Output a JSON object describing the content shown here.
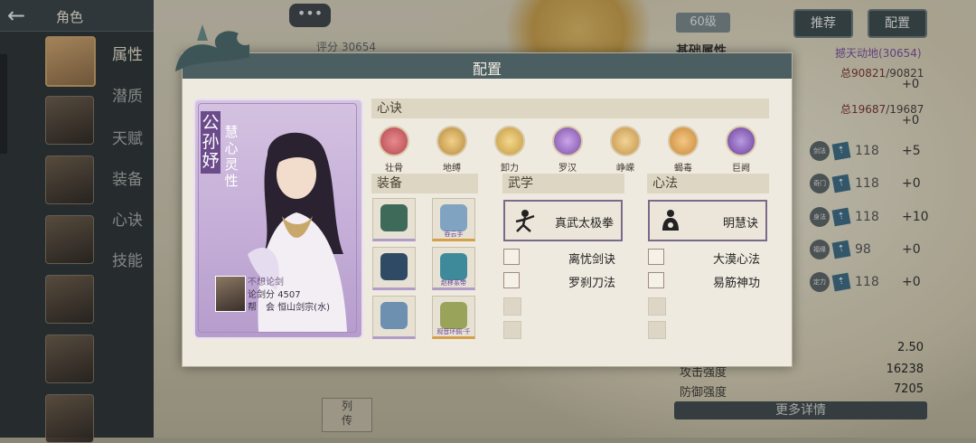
{
  "header": {
    "title": "角色",
    "back_icon": "back-arrow-icon"
  },
  "side_tabs": [
    "属性",
    "潜质",
    "天赋",
    "装备",
    "心诀",
    "技能"
  ],
  "chat": {
    "label": "•••"
  },
  "score_top": "评分 30654",
  "level": "60级",
  "buttons": {
    "recommend": "推荐",
    "config": "配置"
  },
  "right_panel": {
    "title": "基础属性",
    "score": "撼天动地(30654)",
    "hp": {
      "current": "总90821",
      "max": "/90821",
      "plus": "+0"
    },
    "mp": {
      "current": "总19687",
      "max": "/19687",
      "plus": "+0"
    },
    "attrs": [
      {
        "icon": "剑法",
        "value": "118",
        "plus": "+5"
      },
      {
        "icon": "奇门",
        "value": "118",
        "plus": "+0"
      },
      {
        "icon": "身法",
        "value": "118",
        "plus": "+10"
      },
      {
        "icon": "福缘",
        "value": "98",
        "plus": "+0"
      },
      {
        "icon": "定力",
        "value": "118",
        "plus": "+0"
      }
    ],
    "bottom_stats": [
      {
        "label": "",
        "value": "2.50"
      },
      {
        "label": "攻击强度",
        "value": "16238"
      },
      {
        "label": "防御强度",
        "value": "7205"
      }
    ],
    "more": "更多详情"
  },
  "scroll_btn": "列\n传",
  "modal": {
    "title": "配置",
    "character": {
      "name": "公孙妤",
      "trait": "慧心灵性",
      "player_name": "不想论剑",
      "player_score_label": "论剑分",
      "player_score": "4507",
      "guild_label": "帮　会",
      "guild": "恒山剑宗(水)"
    },
    "xinjue": {
      "title": "心诀",
      "items": [
        {
          "label": "壮骨",
          "color": "#b2474f"
        },
        {
          "label": "地缚",
          "color": "#b68b3c"
        },
        {
          "label": "卸力",
          "color": "#c49a3e"
        },
        {
          "label": "罗汉",
          "color": "#7d4fa5"
        },
        {
          "label": "峥嵘",
          "color": "#c39248"
        },
        {
          "label": "蝎毒",
          "color": "#c9893a"
        },
        {
          "label": "巨阙",
          "color": "#6b3f9b"
        }
      ]
    },
    "equipment": {
      "title": "装备",
      "slots": [
        {
          "label": "",
          "color": "#3e6a5a"
        },
        {
          "label": "吞云手",
          "color": "#7fa3c0"
        },
        {
          "label": "",
          "color": "#2e4a64"
        },
        {
          "label": "赵移系带",
          "color": "#3f8a9a"
        },
        {
          "label": "",
          "color": "#6d8fb0"
        },
        {
          "label": "观音环佩·千",
          "color": "#9aa35a"
        }
      ]
    },
    "wuxue": {
      "title": "武学",
      "main": "真武太极拳",
      "subs": [
        "离忧剑诀",
        "罗刹刀法"
      ]
    },
    "xinfa": {
      "title": "心法",
      "main": "明慧诀",
      "subs": [
        "大漠心法",
        "易筋神功"
      ]
    }
  }
}
